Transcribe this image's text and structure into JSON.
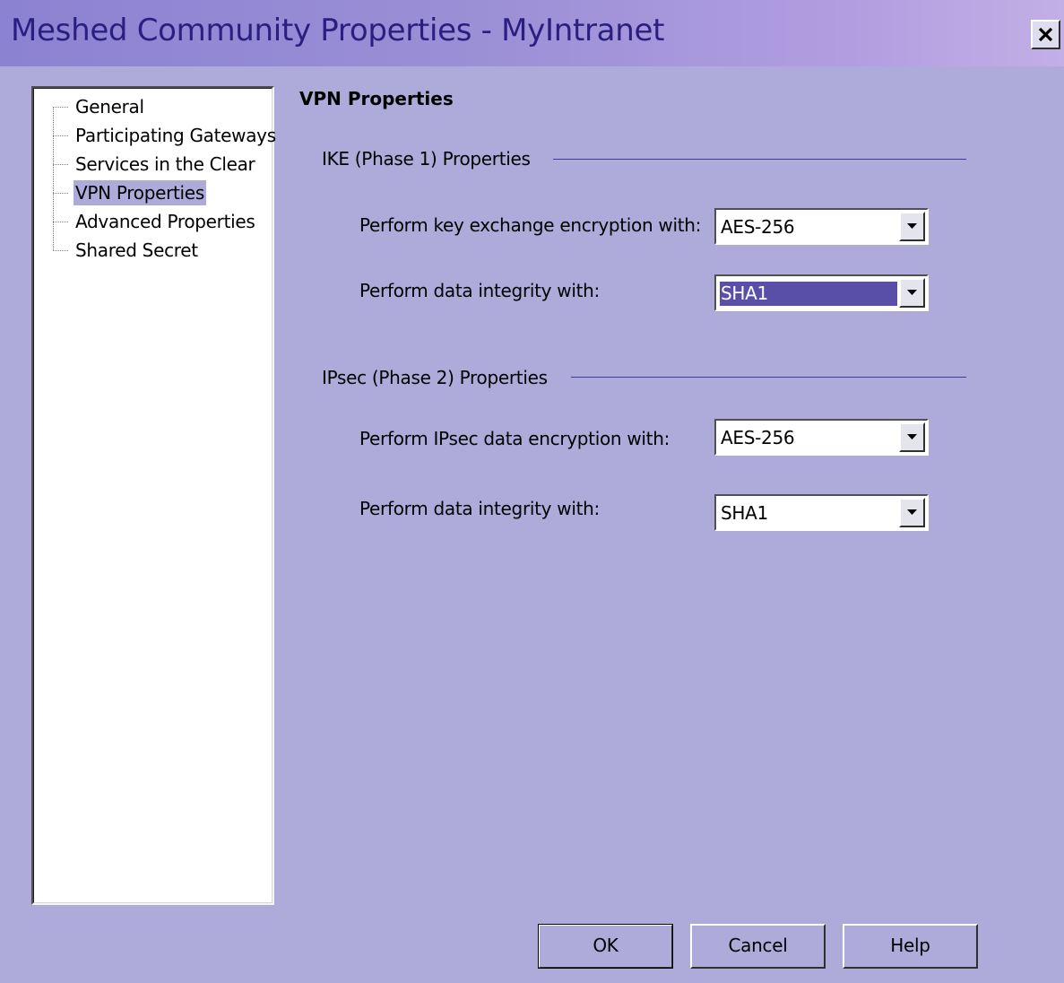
{
  "window": {
    "title": "Meshed Community Properties - MyIntranet",
    "close_label": "close"
  },
  "sidebar": {
    "items": [
      {
        "label": "General",
        "selected": false
      },
      {
        "label": "Participating Gateways",
        "selected": false
      },
      {
        "label": "Services in the Clear",
        "selected": false
      },
      {
        "label": "VPN Properties",
        "selected": true
      },
      {
        "label": "Advanced Properties",
        "selected": false
      },
      {
        "label": "Shared Secret",
        "selected": false
      }
    ]
  },
  "main": {
    "title": "VPN Properties",
    "ike": {
      "group_label": "IKE (Phase 1) Properties",
      "encryption_label": "Perform key exchange encryption with:",
      "encryption_value": "AES-256",
      "integrity_label": "Perform data integrity with:",
      "integrity_value": "SHA1"
    },
    "ipsec": {
      "group_label": "IPsec (Phase 2) Properties",
      "encryption_label": "Perform IPsec data encryption with:",
      "encryption_value": "AES-256",
      "integrity_label": "Perform data integrity with:",
      "integrity_value": "SHA1"
    }
  },
  "buttons": {
    "ok": "OK",
    "cancel": "Cancel",
    "help": "Help"
  },
  "colors": {
    "background": "#aeaad9",
    "title_text": "#2a1f80",
    "focus_highlight": "#5a4fa8"
  }
}
